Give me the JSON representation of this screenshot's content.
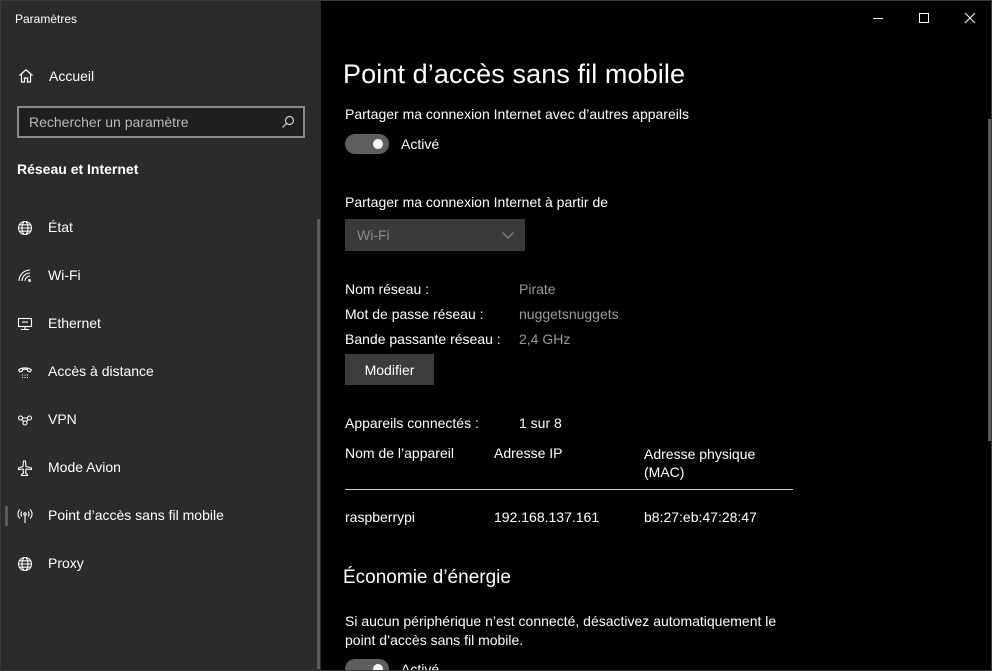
{
  "app": {
    "title": "Paramètres"
  },
  "sidebar": {
    "home_label": "Accueil",
    "search_placeholder": "Rechercher un paramètre",
    "section_title": "Réseau et Internet",
    "items": [
      {
        "label": "État",
        "icon": "globe-icon"
      },
      {
        "label": "Wi-Fi",
        "icon": "wifi-icon"
      },
      {
        "label": "Ethernet",
        "icon": "ethernet-icon"
      },
      {
        "label": "Accès à distance",
        "icon": "dialup-icon"
      },
      {
        "label": "VPN",
        "icon": "vpn-icon"
      },
      {
        "label": "Mode Avion",
        "icon": "airplane-icon"
      },
      {
        "label": "Point d’accès sans fil mobile",
        "icon": "hotspot-icon"
      },
      {
        "label": "Proxy",
        "icon": "globe-icon"
      }
    ],
    "selected_index": 6
  },
  "main": {
    "title": "Point d’accès sans fil mobile",
    "share_label": "Partager ma connexion Internet avec d’autres appareils",
    "share_toggle_state": "Activé",
    "share_from_label": "Partager ma connexion Internet à partir de",
    "share_from_value": "Wi-Fi",
    "network_name_label": "Nom réseau :",
    "network_name_value": "Pirate",
    "password_label": "Mot de passe réseau :",
    "password_value": "nuggetsnuggets",
    "band_label": "Bande passante réseau :",
    "band_value": "2,4 GHz",
    "edit_button": "Modifier",
    "devices_label": "Appareils connectés :",
    "devices_value": "1 sur 8",
    "table": {
      "headers": [
        "Nom de l’appareil",
        "Adresse IP",
        "Adresse physique",
        "(MAC)"
      ],
      "rows": [
        {
          "name": "raspberrypi",
          "ip": "192.168.137.161",
          "mac": "b8:27:eb:47:28:47"
        }
      ]
    },
    "energy_title": "Économie d’énergie",
    "energy_text": "Si aucun périphérique n’est connecté, désactivez automatiquement le point d’accès sans fil mobile.",
    "energy_toggle_state": "Activé"
  },
  "colors": {
    "sidebar_bg": "#2b2b2b",
    "main_bg": "#000000",
    "toggle_on": "#5e5e5e",
    "muted_text": "#9a9a9a"
  }
}
